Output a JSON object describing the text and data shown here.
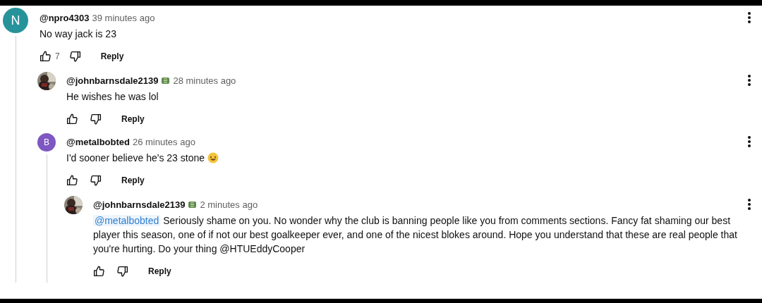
{
  "comments": [
    {
      "author": "@npro4303",
      "badge": false,
      "time": "39 minutes ago",
      "avatar": {
        "kind": "letter",
        "letter": "N",
        "color": "#26939b"
      },
      "text": "No way jack is 23",
      "emoji": false,
      "likes": "7",
      "reply_label": "Reply",
      "children": [
        {
          "author": "@johnbarnsdale2139",
          "badge": true,
          "time": "28 minutes ago",
          "text": "He wishes he was lol",
          "emoji": false,
          "reply_label": "Reply"
        },
        {
          "author": "@metalbobted",
          "badge": false,
          "time": "26 minutes ago",
          "avatar": {
            "kind": "letter",
            "letter": "B",
            "color": "#7e57c2"
          },
          "text": "I'd sooner believe he's 23 stone",
          "emoji": true,
          "reply_label": "Reply",
          "children": [
            {
              "author": "@johnbarnsdale2139",
              "badge": true,
              "time": "2 minutes ago",
              "mention": "@metalbobted",
              "text": "Seriously shame on you. No wonder why the club is banning people like you from comments sections. Fancy fat shaming our best player this season, one of if not our best goalkeeper ever, and one of the nicest blokes around. Hope you understand that these are real people that you're hurting. Do your thing @HTUEddyCooper",
              "emoji": false,
              "reply_label": "Reply"
            }
          ]
        }
      ]
    }
  ]
}
